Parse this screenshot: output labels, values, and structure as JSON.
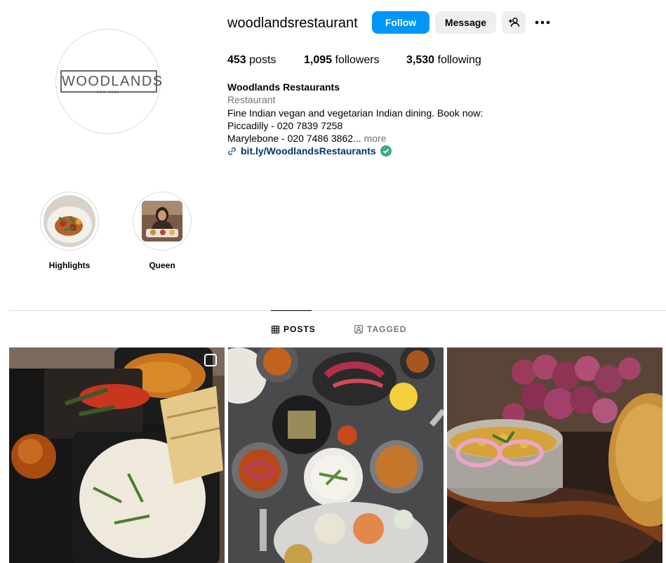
{
  "profile": {
    "username": "woodlandsrestaurant",
    "logo_text": "WOODLANDS",
    "logo_sub": "EST. 1981",
    "follow_label": "Follow",
    "message_label": "Message",
    "add_user_icon": "person-plus-icon",
    "more_icon": "more-horizontal-icon"
  },
  "stats": {
    "posts_count": "453",
    "posts_label": "posts",
    "followers_count": "1,095",
    "followers_label": "followers",
    "following_count": "3,530",
    "following_label": "following"
  },
  "bio": {
    "full_name": "Woodlands Restaurants",
    "category": "Restaurant",
    "line1": "Fine Indian vegan and vegetarian Indian dining. Book now:",
    "line2": "Piccadilly - 020 7839 7258",
    "line3": "Marylebone - 020 7486 3862...",
    "more": "more",
    "link": "bit.ly/WoodlandsRestaurants",
    "link_icon": "link-icon",
    "verified_icon": "verified-check-icon"
  },
  "highlights": [
    {
      "label": "Highlights"
    },
    {
      "label": "Queen"
    }
  ],
  "tabs": {
    "posts": "POSTS",
    "tagged": "TAGGED"
  },
  "colors": {
    "accent": "#0095f6",
    "link": "#00376b",
    "muted": "#737373",
    "verified": "#3fa98a"
  }
}
